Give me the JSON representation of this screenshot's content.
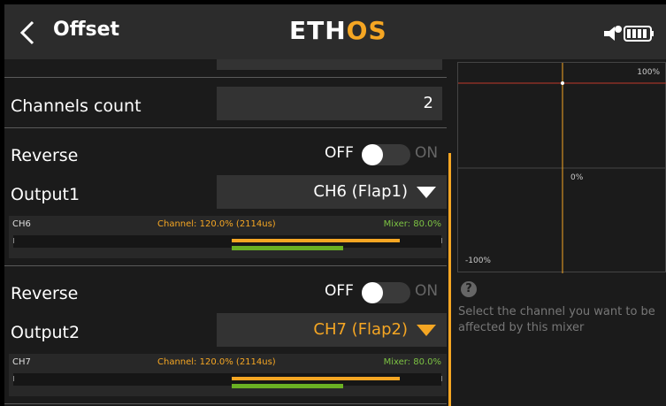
{
  "header": {
    "back_icon": "chevron-left-icon",
    "title": "Offset",
    "logo_main": "ETH",
    "logo_accent": "OS",
    "status_icons": [
      "speaker-icon",
      "battery-icon"
    ]
  },
  "form": {
    "channels_count_label": "Channels count",
    "channels_count_value": "2",
    "blocks": [
      {
        "reverse_label": "Reverse",
        "reverse_off": "OFF",
        "reverse_on": "ON",
        "reverse_state": false,
        "output_label": "Output1",
        "output_value": "CH6 (Flap1)",
        "output_value_color": "#ffffff",
        "monitor": {
          "channel": "CH6",
          "channel_text": "Channel: 120.0% (2114us)",
          "mixer_text": "Mixer: 80.0%",
          "channel_percent": 120.0,
          "mixer_percent": 80.0
        }
      },
      {
        "reverse_label": "Reverse",
        "reverse_off": "OFF",
        "reverse_on": "ON",
        "reverse_state": false,
        "output_label": "Output2",
        "output_value": "CH7 (Flap2)",
        "output_value_color": "#f5a623",
        "monitor": {
          "channel": "CH7",
          "channel_text": "Channel: 120.0% (2114us)",
          "mixer_text": "Mixer: 80.0%",
          "channel_percent": 120.0,
          "mixer_percent": 80.0
        }
      }
    ]
  },
  "graph": {
    "top_label": "100%",
    "mid_label": "0%",
    "bottom_label": "-100%"
  },
  "help": {
    "icon": "question-icon",
    "text": "Select the channel you want to be affected by this mixer"
  },
  "colors": {
    "accent": "#f5a623",
    "mixer_green": "#6ab023",
    "graph_red": "#c0392b"
  }
}
